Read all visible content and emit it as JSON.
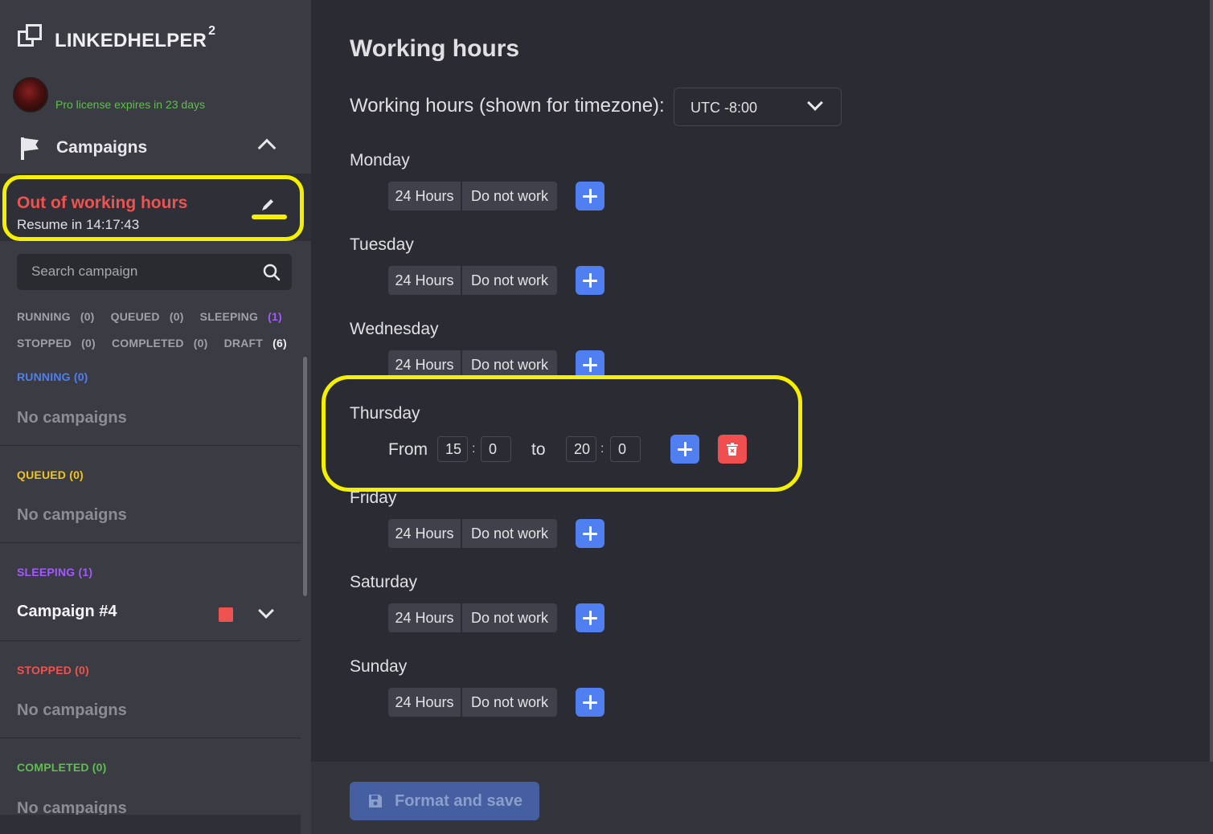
{
  "app": {
    "logo_text": "LINKEDHELPER",
    "logo_sup": "2",
    "license_text": "Pro license expires in 23 days"
  },
  "sidebar": {
    "campaigns_label": "Campaigns",
    "status_title": "Out of working hours",
    "status_sub": "Resume in 14:17:43",
    "search_placeholder": "Search campaign",
    "filters_row1": [
      {
        "label": "RUNNING",
        "count": "(0)"
      },
      {
        "label": "QUEUED",
        "count": "(0)"
      },
      {
        "label": "SLEEPING",
        "count": "(1)"
      }
    ],
    "filters_row2": [
      {
        "label": "STOPPED",
        "count": "(0)"
      },
      {
        "label": "COMPLETED",
        "count": "(0)"
      },
      {
        "label": "DRAFT",
        "count": "(6)"
      }
    ],
    "sections": [
      {
        "label": "RUNNING",
        "count": "(0)",
        "color": "#4f7ff0",
        "empty": "No campaigns"
      },
      {
        "label": "QUEUED",
        "count": "(0)",
        "color": "#f0c419",
        "empty": "No campaigns"
      },
      {
        "label": "SLEEPING",
        "count": "(1)",
        "color": "#a259ff",
        "campaign": "Campaign #4"
      },
      {
        "label": "STOPPED",
        "count": "(0)",
        "color": "#ef5350",
        "empty": "No campaigns"
      },
      {
        "label": "COMPLETED",
        "count": "(0)",
        "color": "#5fbf4f",
        "empty": "No campaigns"
      }
    ]
  },
  "main": {
    "title": "Working hours",
    "timezone_label": "Working hours (shown for timezone):",
    "timezone_value": "UTC -8:00",
    "preset_24": "24 Hours",
    "preset_off": "Do not work",
    "days": [
      "Monday",
      "Tuesday",
      "Wednesday",
      "Thursday",
      "Friday",
      "Saturday",
      "Sunday"
    ],
    "thursday": {
      "from_label": "From",
      "to_label": "to",
      "from_h": "15",
      "from_m": "0",
      "to_h": "20",
      "to_m": "0",
      "sep": ":"
    },
    "save_label": "Format and save"
  },
  "colors": {
    "accent_blue": "#4f7ff0",
    "danger_red": "#ef4f4f",
    "highlight_yellow": "#f5f000"
  }
}
